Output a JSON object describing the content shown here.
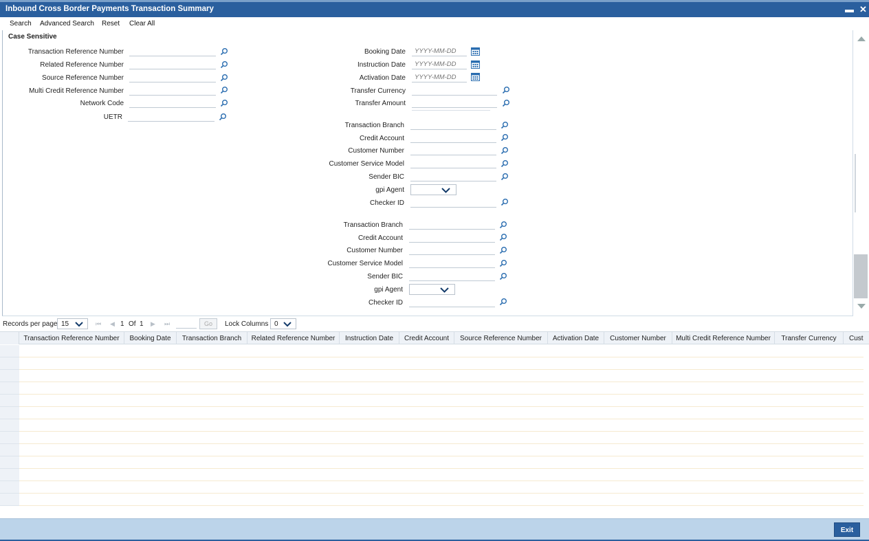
{
  "window": {
    "title": "Inbound Cross Border Payments Transaction Summary",
    "minimize_glyph": "▬",
    "close_glyph": "✕"
  },
  "toolbar": {
    "search": "Search",
    "advanced_search": "Advanced Search",
    "reset": "Reset",
    "clear_all": "Clear All"
  },
  "criteria": {
    "section_title": "Case Sensitive",
    "left_fields": [
      {
        "label": "Transaction Reference Number",
        "value": ""
      },
      {
        "label": "Related Reference Number",
        "value": ""
      },
      {
        "label": "Source Reference Number",
        "value": ""
      },
      {
        "label": "Multi Credit Reference Number",
        "value": ""
      },
      {
        "label": "Network Code",
        "value": ""
      },
      {
        "label": "UETR",
        "value": ""
      }
    ],
    "date_fields": [
      {
        "label": "Booking Date",
        "placeholder": "YYYY-MM-DD"
      },
      {
        "label": "Instruction Date",
        "placeholder": "YYYY-MM-DD"
      },
      {
        "label": "Activation Date",
        "placeholder": "YYYY-MM-DD"
      }
    ],
    "mid_fields": [
      {
        "label": "Transfer Currency",
        "value": ""
      },
      {
        "label": "Transfer Amount",
        "value": ""
      }
    ],
    "group_a": [
      {
        "label": "Transaction Branch"
      },
      {
        "label": "Credit Account"
      },
      {
        "label": "Customer Number"
      },
      {
        "label": "Customer Service Model"
      },
      {
        "label": "Sender BIC"
      },
      {
        "label": "gpi Agent"
      },
      {
        "label": "Checker ID"
      }
    ],
    "group_b": [
      {
        "label": "Transaction Branch"
      },
      {
        "label": "Credit Account"
      },
      {
        "label": "Customer Number"
      },
      {
        "label": "Customer Service Model"
      },
      {
        "label": "Sender BIC"
      },
      {
        "label": "gpi Agent"
      },
      {
        "label": "Checker ID"
      }
    ]
  },
  "pager": {
    "records_per_page_label": "Records per page",
    "records_per_page": "15",
    "current_page": "1",
    "of_label": "Of",
    "total_pages": "1",
    "go_label": "Go",
    "lock_columns_label": "Lock Columns",
    "lock_columns": "0"
  },
  "grid": {
    "columns": [
      "Transaction Reference Number",
      "Booking Date",
      "Transaction Branch",
      "Related Reference Number",
      "Instruction Date",
      "Credit Account",
      "Source Reference Number",
      "Activation Date",
      "Customer Number",
      "Multi Credit Reference Number",
      "Transfer Currency",
      "Cust"
    ],
    "row_count": 13
  },
  "footer": {
    "exit_label": "Exit"
  },
  "icons": {
    "lov": "magnifier-icon",
    "calendar": "calendar-icon",
    "dropdown": "chevron-down-icon"
  },
  "colors": {
    "accent": "#2a5f9e",
    "footer_bg": "#bcd4ea",
    "grid_header_bg": "#eef2f7"
  }
}
